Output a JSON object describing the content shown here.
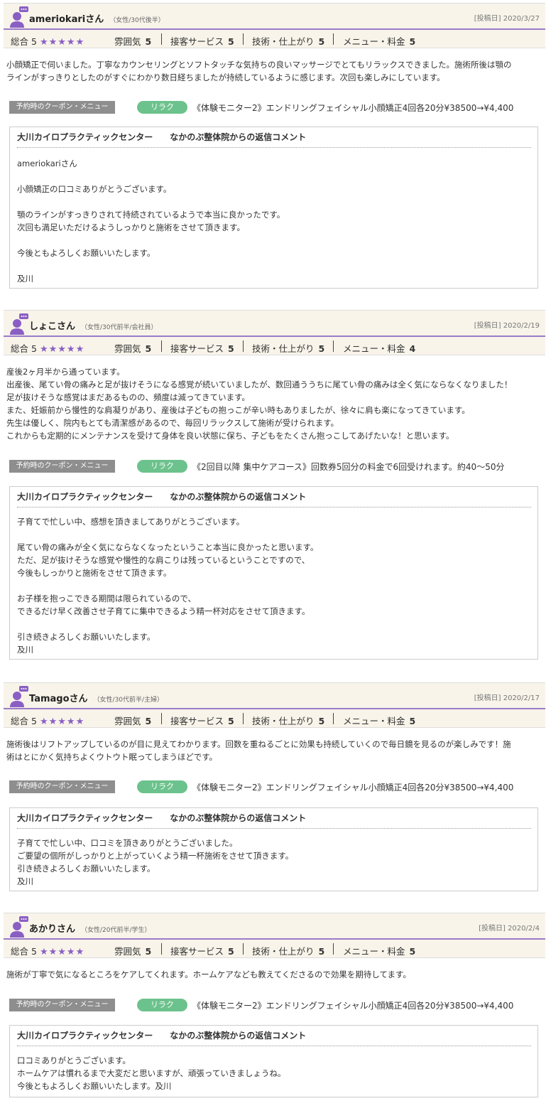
{
  "labels": {
    "overall": "総合",
    "atmosphere": "雰囲気",
    "service": "接客サービス",
    "technique": "技術・仕上がり",
    "menu_price": "メニュー・料金",
    "coupon_label": "予約時のクーポン・メニュー",
    "coupon_tag": "リラク",
    "reply_title": "大川カイロプラクティックセンター　　なかのぶ整体院からの返信コメント"
  },
  "colors": {
    "accent": "#9a7bc9",
    "star": "#8a5fc4",
    "tag": "#6cc28c",
    "header_bg": "#f8f4ea"
  },
  "reviews": [
    {
      "name": "ameriokariさん",
      "profile": "（女性/30代後半）",
      "date": "[投稿日] 2020/3/27",
      "overall": "5",
      "atmosphere": "5",
      "service": "5",
      "technique": "5",
      "menu_price": "5",
      "stars": "★★★★★",
      "body": "小顔矯正で伺いました。丁寧なカウンセリングとソフトタッチな気持ちの良いマッサージでとてもリラックスできました。施術所後は顎の\nラインがすっきりとしたのがすぐにわかり数日経ちましたが持続しているように感じます。次回も楽しみにしています。",
      "coupon": "《体験モニター2》エンドリングフェイシャル小顔矯正4回各20分¥38500→¥4,400",
      "reply": "ameriokariさん\n\n小顔矯正の口コミありがとうございます。\n\n顎のラインがすっきりされて持続されているようで本当に良かったです。\n次回も満足いただけるようしっかりと施術をさせて頂きます。\n\n今後ともよろしくお願いいたします。\n\n及川"
    },
    {
      "name": "しょこさん",
      "profile": "（女性/30代前半/会社員）",
      "date": "[投稿日] 2020/2/19",
      "overall": "5",
      "atmosphere": "5",
      "service": "5",
      "technique": "5",
      "menu_price": "4",
      "stars": "★★★★★",
      "body": "産後2ヶ月半から通っています。\n出産後、尾てい骨の痛みと足が抜けそうになる感覚が続いていましたが、数回通ううちに尾てい骨の痛みは全く気にならなくなりました！\n足が抜けそうな感覚はまだあるものの、頻度は減ってきています。\nまた、妊娠前から慢性的な肩凝りがあり、産後は子どもの抱っこが辛い時もありましたが、徐々に肩も楽になってきています。\n先生は優しく、院内もとても清潔感があるので、毎回リラックスして施術が受けられます。\nこれからも定期的にメンテナンスを受けて身体を良い状態に保ち、子どもをたくさん抱っこしてあげたいな！と思います。",
      "coupon": "《2回目以降 集中ケアコース》回数券5回分の料金で6回受けれます。約40～50分",
      "reply": "子育てで忙しい中、感想を頂きましてありがとうございます。\n\n尾てい骨の痛みが全く気にならなくなったということ本当に良かったと思います。\nただ、足が抜けそうな感覚や慢性的な肩こりは残っているということですので、\n今後もしっかりと施術をさせて頂きます。\n\nお子様を抱っこできる期間は限られているので、\nできるだけ早く改善させ子育てに集中できるよう精一杯対応をさせて頂きます。\n\n引き続きよろしくお願いいたします。\n及川"
    },
    {
      "name": "Tamagoさん",
      "profile": "（女性/30代前半/主婦）",
      "date": "[投稿日] 2020/2/17",
      "overall": "5",
      "atmosphere": "5",
      "service": "5",
      "technique": "5",
      "menu_price": "5",
      "stars": "★★★★★",
      "body": "施術後はリフトアップしているのが目に見えてわかります。回数を重ねるごとに効果も持続していくので毎日鏡を見るのが楽しみです！施\n術はとにかく気持ちよくウトウト眠ってしまうほどです。",
      "coupon": "《体験モニター2》エンドリングフェイシャル小顔矯正4回各20分¥38500→¥4,400",
      "reply": "子育てで忙しい中、口コミを頂きありがとうございました。\nご要望の個所がしっかりと上がっていくよう精一杯施術をさせて頂きます。\n引き続きよろしくお願いいたします。\n及川"
    },
    {
      "name": "あかりさん",
      "profile": "（女性/20代前半/学生）",
      "date": "[投稿日] 2020/2/4",
      "overall": "5",
      "atmosphere": "5",
      "service": "5",
      "technique": "5",
      "menu_price": "5",
      "stars": "★★★★★",
      "body": "施術が丁寧で気になるところをケアしてくれます。ホームケアなども教えてくださるので効果を期待してます。",
      "coupon": "《体験モニター2》エンドリングフェイシャル小顔矯正4回各20分¥38500→¥4,400",
      "reply": "口コミありがとうございます。\nホームケアは慣れるまで大変だと思いますが、頑張っていきましょうね。\n今後ともよろしくお願いいたします。及川"
    }
  ]
}
